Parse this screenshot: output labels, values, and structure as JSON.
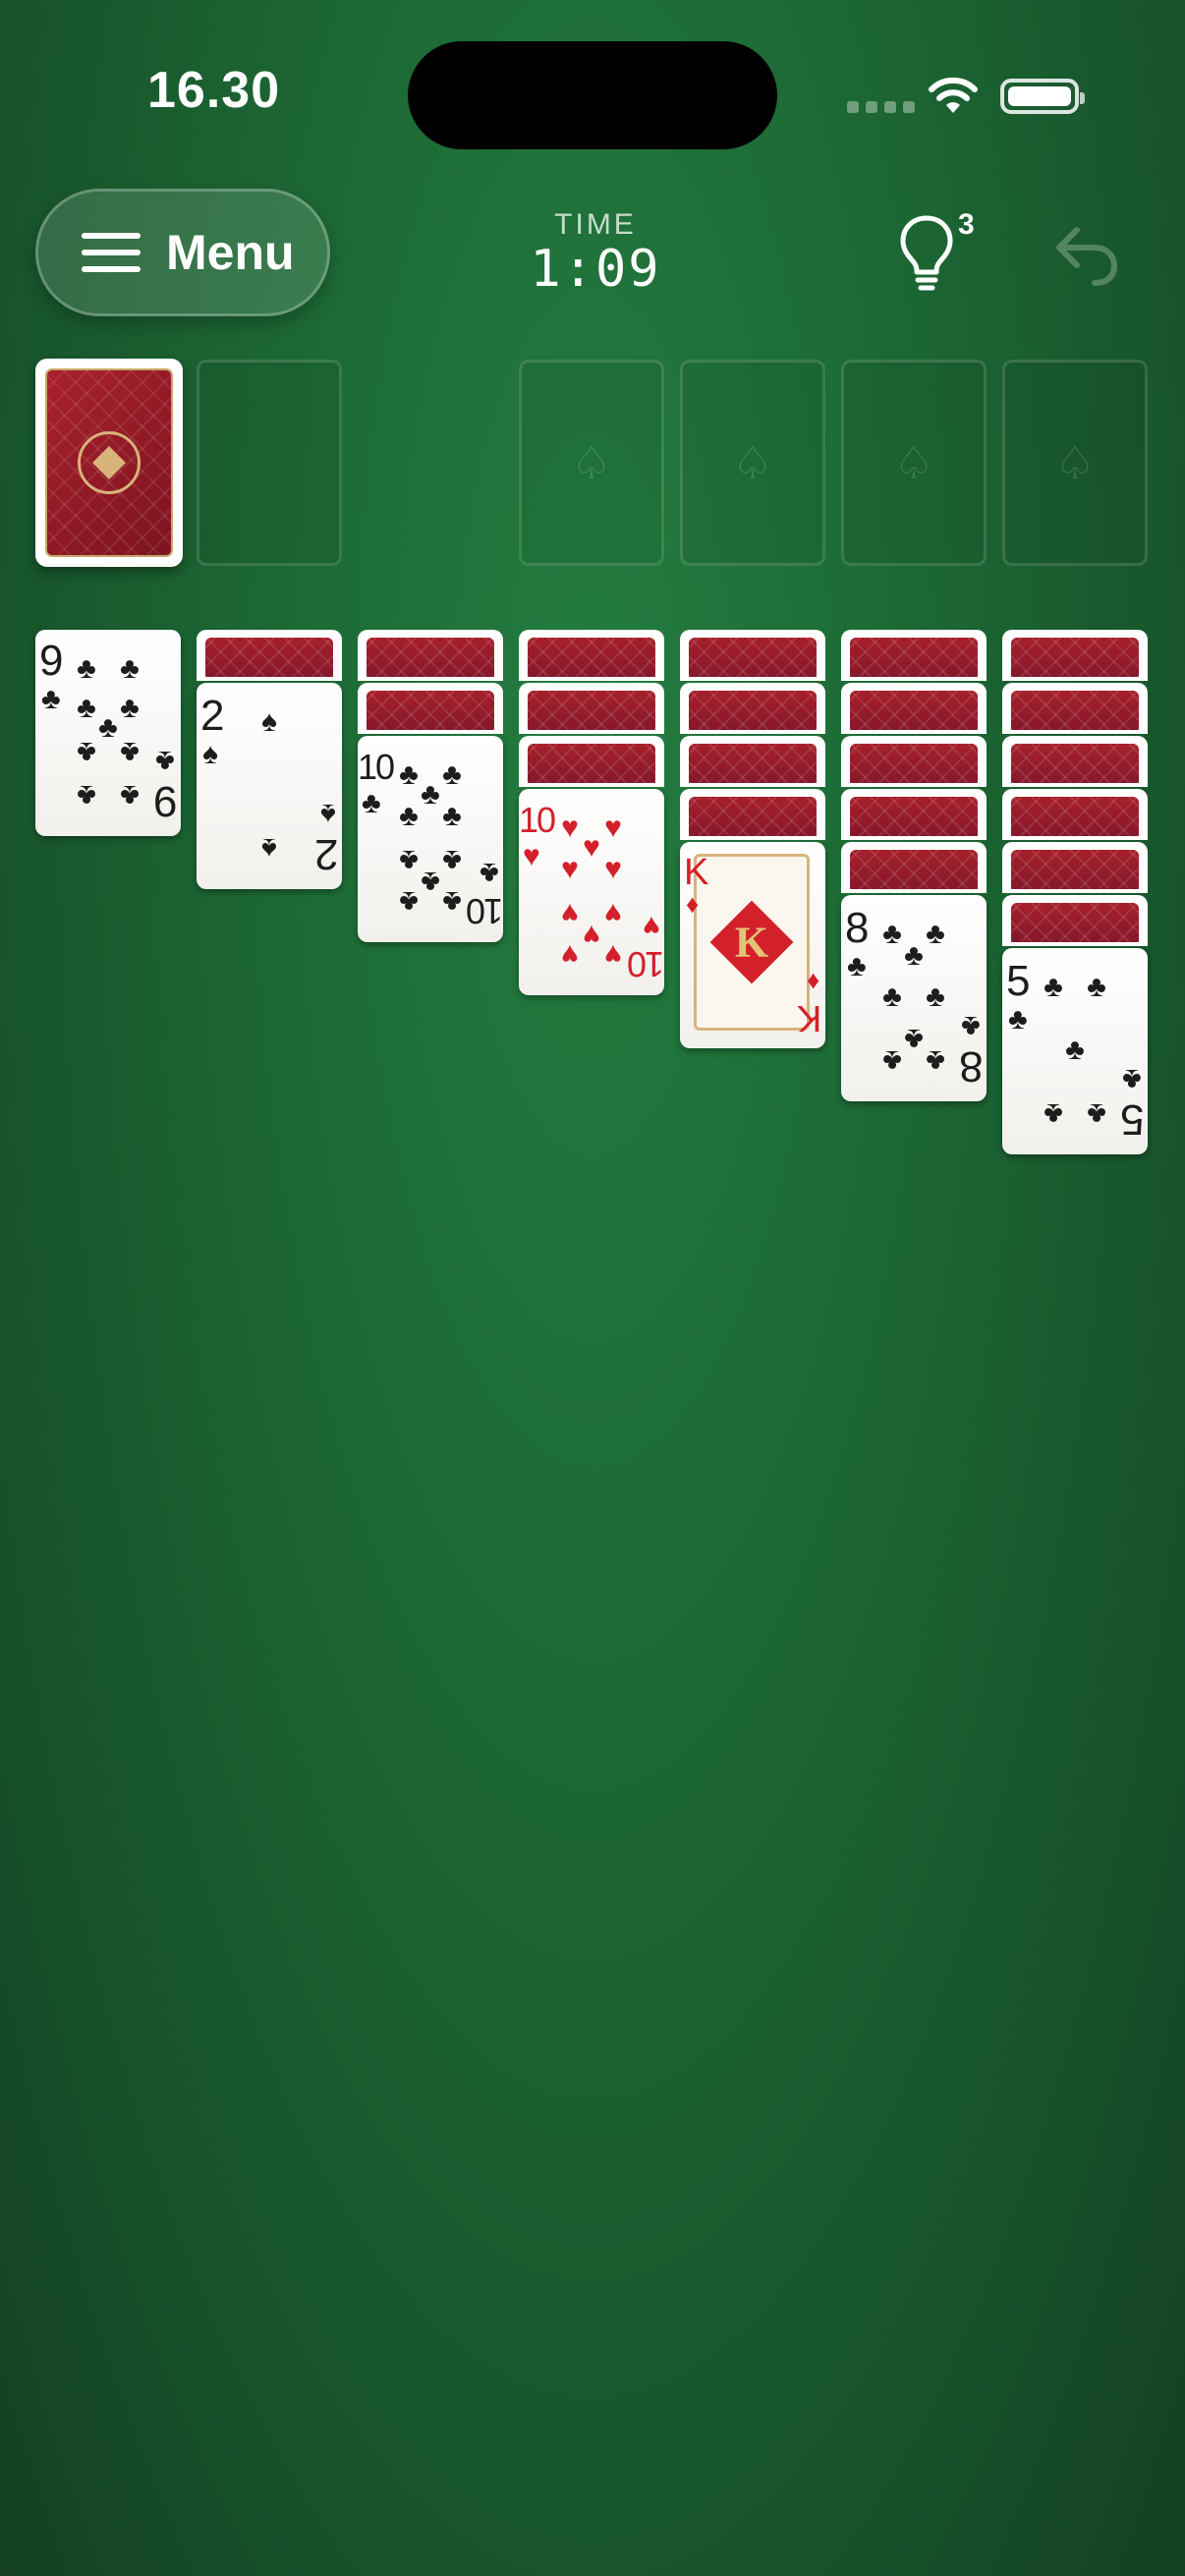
{
  "status_bar": {
    "time": "16.30"
  },
  "toolbar": {
    "menu_label": "Menu",
    "time_label": "TIME",
    "time_value": "1:09",
    "hints_count": "3"
  },
  "foundations": {
    "suit_icon": "♤",
    "count": 4
  },
  "tableau": [
    {
      "face_down": 0,
      "face_up": {
        "rank": "9",
        "suit": "♣",
        "color": "black"
      }
    },
    {
      "face_down": 1,
      "face_up": {
        "rank": "2",
        "suit": "♠",
        "color": "black"
      }
    },
    {
      "face_down": 2,
      "face_up": {
        "rank": "10",
        "suit": "♣",
        "color": "black"
      }
    },
    {
      "face_down": 3,
      "face_up": {
        "rank": "10",
        "suit": "♥",
        "color": "red"
      }
    },
    {
      "face_down": 4,
      "face_up": {
        "rank": "K",
        "suit": "♦",
        "color": "red"
      }
    },
    {
      "face_down": 5,
      "face_up": {
        "rank": "8",
        "suit": "♣",
        "color": "black"
      }
    },
    {
      "face_down": 6,
      "face_up": {
        "rank": "5",
        "suit": "♣",
        "color": "black"
      }
    }
  ],
  "colors": {
    "felt": "#1d6a35",
    "card_back": "#9c1c28",
    "red_suit": "#d4202a",
    "gold_trim": "#d8b37a"
  }
}
